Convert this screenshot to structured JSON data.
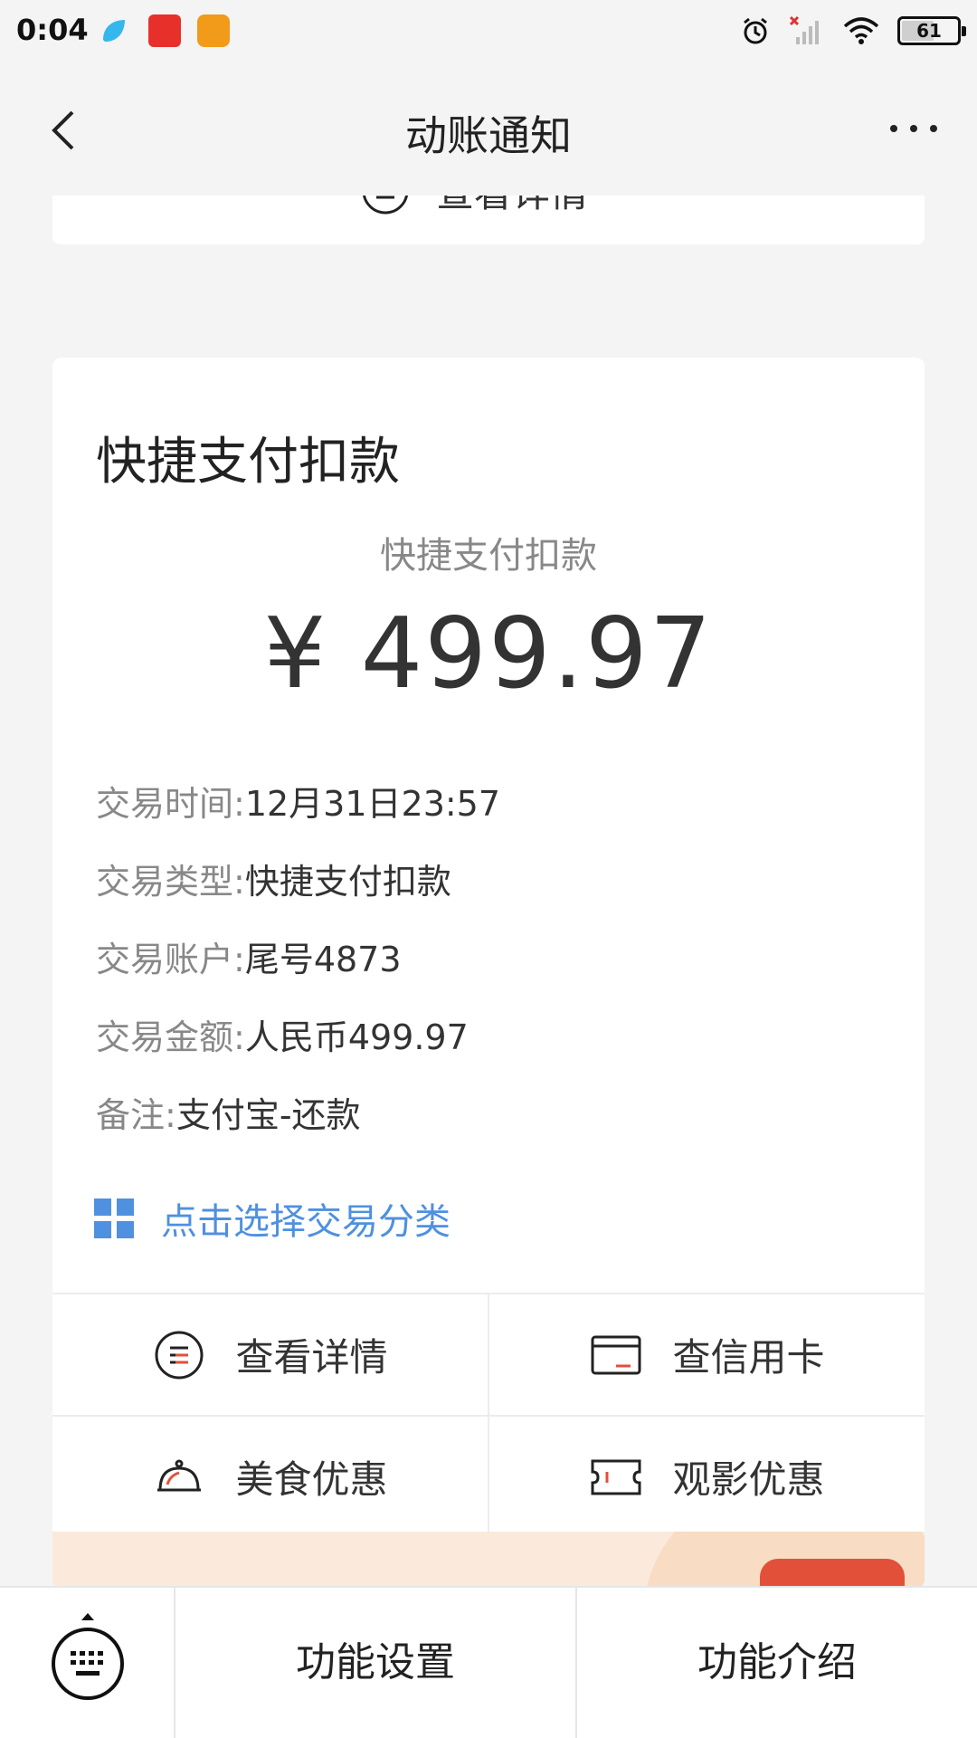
{
  "status_bar": {
    "time": "0:04",
    "battery": "61",
    "battery_fraction": 0.61,
    "icons": [
      "alarm-icon",
      "signal-off-icon",
      "wifi-icon",
      "battery-icon"
    ]
  },
  "nav": {
    "title": "动账通知",
    "back_icon": "chevron-left-icon",
    "more_icon": "more-icon"
  },
  "partial_card": {
    "action_label": "查看详情"
  },
  "notice": {
    "title": "快捷支付扣款",
    "subtitle": "快捷支付扣款",
    "amount": "¥ 499.97",
    "details": [
      {
        "label": "交易时间:",
        "value": "12月31日23:57"
      },
      {
        "label": "交易类型:",
        "value": "快捷支付扣款"
      },
      {
        "label": "交易账户:",
        "value": "尾号4873"
      },
      {
        "label": "交易金额:",
        "value": "人民币499.97"
      },
      {
        "label": "备注:",
        "value": "支付宝-还款"
      }
    ],
    "category_link": "点击选择交易分类",
    "actions": [
      {
        "label": "查看详情",
        "icon": "list-circle-icon"
      },
      {
        "label": "查信用卡",
        "icon": "credit-card-icon"
      },
      {
        "label": "美食优惠",
        "icon": "food-cloche-icon"
      },
      {
        "label": "观影优惠",
        "icon": "ticket-icon"
      }
    ]
  },
  "bottom_bar": {
    "keyboard_icon": "keyboard-icon",
    "buttons": [
      "功能设置",
      "功能介绍"
    ]
  },
  "colors": {
    "accent_blue": "#4f90e0",
    "accent_red": "#e2503a",
    "background": "#f4f4f4"
  }
}
